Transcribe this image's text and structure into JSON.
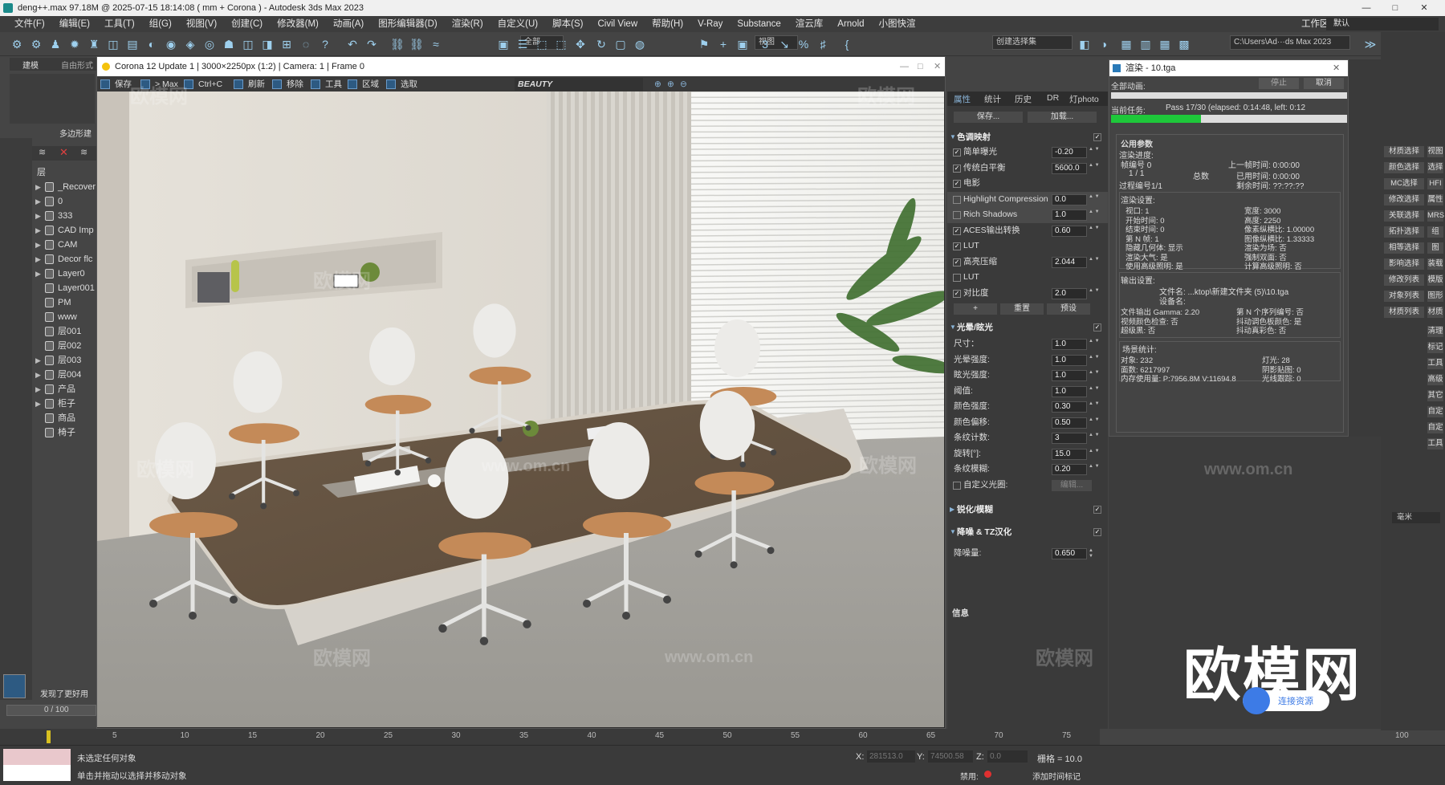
{
  "window": {
    "title": "deng++.max  97.18M @ 2025-07-15 18:14:08  ( mm + Corona ) - Autodesk 3ds Max 2023"
  },
  "menu": [
    "文件(F)",
    "编辑(E)",
    "工具(T)",
    "组(G)",
    "视图(V)",
    "创建(C)",
    "修改器(M)",
    "动画(A)",
    "图形编辑器(D)",
    "渲染(R)",
    "自定义(U)",
    "脚本(S)",
    "Civil View",
    "帮助(H)",
    "V-Ray",
    "Substance",
    "渲云库",
    "Arnold",
    "小图快渲"
  ],
  "workspace": {
    "label": "工作区:",
    "value": "默认"
  },
  "toolbar": {
    "selection_filter": "全部",
    "view_dropdown": "视图",
    "selection_set": "创建选择集",
    "path": "C:\\Users\\Ad···ds Max 2023"
  },
  "left_panel": {
    "tabs": [
      "建模",
      "自由形式"
    ],
    "poly_label": "多边形建",
    "layers_header": "层",
    "layers": [
      {
        "name": "_Recover",
        "exp": true
      },
      {
        "name": "0",
        "exp": true
      },
      {
        "name": "333",
        "exp": true
      },
      {
        "name": "CAD Imp",
        "exp": true
      },
      {
        "name": "CAM",
        "exp": true
      },
      {
        "name": "Decor flc",
        "exp": true
      },
      {
        "name": "Layer0",
        "exp": true
      },
      {
        "name": "Layer001",
        "exp": false
      },
      {
        "name": "PM",
        "exp": false
      },
      {
        "name": "www",
        "exp": false
      },
      {
        "name": "层001",
        "exp": false
      },
      {
        "name": "层002",
        "exp": false
      },
      {
        "name": "层003",
        "exp": true
      },
      {
        "name": "层004",
        "exp": true
      },
      {
        "name": "产品",
        "exp": true
      },
      {
        "name": "柜子",
        "exp": true
      },
      {
        "name": "商品",
        "exp": false
      },
      {
        "name": "椅子",
        "exp": false
      }
    ],
    "found_better": "发现了更好用",
    "frame_counter": "0 / 100"
  },
  "vfb": {
    "title": "Corona 12 Update 1 | 3000×2250px (1:2) | Camera: 1 | Frame 0",
    "tools": [
      "保存",
      "> Max",
      "Ctrl+C",
      "刷新",
      "移除",
      "工具",
      "区域",
      "选取"
    ],
    "beauty": "BEAUTY"
  },
  "props": {
    "tabs": [
      "属性",
      "统计",
      "历史",
      "DR",
      "灯photo"
    ],
    "save": "保存...",
    "load": "加载...",
    "tonemap_title": "色调映射",
    "tonemap": [
      {
        "label": "简单曝光",
        "checked": true,
        "value": "-0.20"
      },
      {
        "label": "传统白平衡",
        "checked": true,
        "value": "5600.0"
      },
      {
        "label": "电影",
        "checked": true,
        "value": ""
      },
      {
        "label": "Highlight Compression",
        "checked": false,
        "value": "0.0"
      },
      {
        "label": "Rich Shadows",
        "checked": false,
        "value": "1.0"
      },
      {
        "label": "ACES输出转换",
        "checked": true,
        "value": "0.60"
      },
      {
        "label": "LUT",
        "checked": true,
        "value": ""
      },
      {
        "label": "高亮压缩",
        "checked": true,
        "value": "2.044"
      },
      {
        "label": "LUT",
        "checked": false,
        "value": ""
      },
      {
        "label": "对比度",
        "checked": true,
        "value": "2.0"
      }
    ],
    "tm_buttons": [
      "+",
      "重置",
      "预设"
    ],
    "bloom_title": "光晕/眩光",
    "bloom": [
      {
        "label": "尺寸：",
        "value": "1.0"
      },
      {
        "label": "光晕强度:",
        "value": "1.0"
      },
      {
        "label": "眩光强度:",
        "value": "1.0"
      },
      {
        "label": "阈值:",
        "value": "1.0"
      },
      {
        "label": "颜色强度:",
        "value": "0.30"
      },
      {
        "label": "颜色偏移:",
        "value": "0.50"
      },
      {
        "label": "条纹计数:",
        "value": "3"
      },
      {
        "label": "旋转[°]:",
        "value": "15.0"
      },
      {
        "label": "条纹模糊:",
        "value": "0.20"
      }
    ],
    "custom_aperture": "自定义光圈:",
    "edit": "编辑...",
    "sharpen_title": "锐化/模糊",
    "denoise_title": "降噪 & TZ汉化",
    "denoise_label": "降噪量:",
    "denoise_value": "0.650",
    "info": "信息"
  },
  "render_dialog": {
    "title": "渲染 - 10.tga",
    "all_anim": "全部动画:",
    "stop": "停止",
    "cancel": "取消",
    "current_task_label": "当前任务:",
    "current_task": "Pass 17/30 (elapsed: 0:14:48, left: 0:12",
    "progress": 0.38,
    "common_params": "公用参数",
    "progress_label": "渲染进度:",
    "frame_label": "帧编号 0",
    "frame_count": "1 / 1",
    "total": "总数",
    "pass_label": "过程编号1/1",
    "last_time": "上一帧时间:  0:00:00",
    "used_time": "已用时间:  0:00:00",
    "remaining": "剩余时间:  ??:??:??",
    "settings_label": "渲染设置:",
    "settings_left": [
      "视口: 1",
      "开始时间: 0",
      "结束时间: 0",
      "第 N 帧: 1",
      "隐藏几何体: 显示",
      "渲染大气: 是",
      "使用高级照明: 是"
    ],
    "settings_right": [
      "宽度: 3000",
      "高度: 2250",
      "像素纵横比: 1.00000",
      "图像纵横比: 1.33333",
      "渲染为场: 否",
      "强制双面: 否",
      "计算高级照明: 否"
    ],
    "output_label": "输出设置:",
    "output_lines": [
      "文件名: ...ktop\\新建文件夹 (5)\\10.tga",
      "设备名:"
    ],
    "output_left": [
      "文件输出 Gamma: 2.20",
      "视频颜色检查: 否",
      "超级黑: 否"
    ],
    "output_right": [
      "第 N 个序列编号: 否",
      "抖动调色板颜色: 是",
      "抖动真彩色: 否"
    ],
    "stats_label": "场景统计:",
    "stats_left": [
      "对象: 232",
      "面数: 6217997",
      "内存使用量: P:7956.8M V:11694.8"
    ],
    "stats_right": [
      "灯光: 28",
      "阴影贴图: 0",
      "光线跟踪: 0"
    ]
  },
  "right_col": [
    "材质选择",
    "视图",
    "颜色选择",
    "选择",
    "MC选择",
    "HFI",
    "修改选择",
    "属性",
    "关联选择",
    "MRS",
    "拓扑选择",
    "组",
    "相等选择",
    "图",
    "影响选择",
    "装载",
    "修改列表",
    "模版",
    "对象列表",
    "图形",
    "材质列表",
    "材质"
  ],
  "right_misc": [
    "清理",
    "标记",
    "工具",
    "高级",
    "其它",
    "自定",
    "自定",
    "工具"
  ],
  "units": "毫米",
  "timeline": {
    "ticks": [
      "5",
      "10",
      "15",
      "20",
      "25",
      "30",
      "35",
      "40",
      "45",
      "50",
      "55",
      "60",
      "65",
      "70",
      "75"
    ],
    "right": "100"
  },
  "status": {
    "no_selection": "未选定任何对象",
    "hint": "单击并拖动以选择并移动对象",
    "x_label": "X:",
    "x_val": "281513.0",
    "y_label": "Y:",
    "y_val": "74500.58",
    "z_label": "Z:",
    "z_val": "0.0",
    "grid": "栅格 = 10.0",
    "disabled": "禁用:",
    "add_time": "添加时间标记"
  },
  "watermarks": {
    "text": "欧模网",
    "url": "www.om.cn",
    "logo": "欧模网",
    "badge": "连接资源"
  }
}
